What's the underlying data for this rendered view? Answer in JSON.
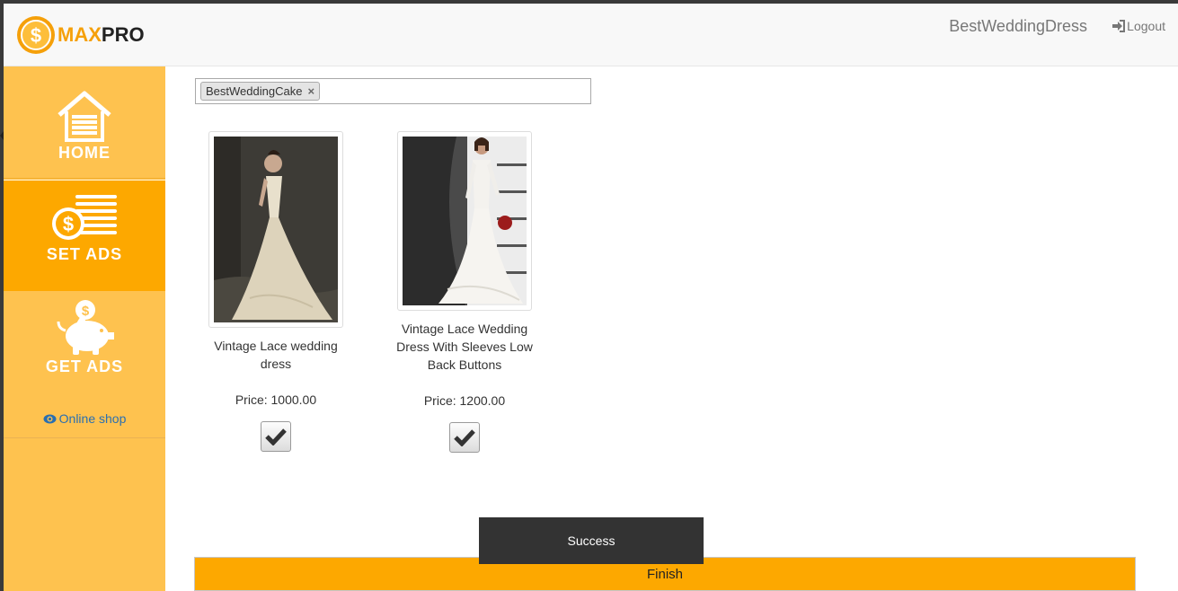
{
  "header": {
    "logo_max": "MAX",
    "logo_pro": "PRO",
    "username": "BestWeddingDress",
    "logout_label": "Logout"
  },
  "sidebar": {
    "items": [
      {
        "label": "HOME",
        "icon": "garage-home-icon"
      },
      {
        "label": "SET ADS",
        "icon": "coin-stack-icon",
        "active": true
      },
      {
        "label": "GET ADS",
        "icon": "piggy-bank-icon"
      }
    ],
    "online_shop": "Online shop"
  },
  "tag_input": {
    "tags": [
      "BestWeddingCake"
    ],
    "remove_glyph": "×"
  },
  "products": [
    {
      "title": "Vintage Lace wedding dress",
      "price": "Price: 1000.00",
      "checked": true
    },
    {
      "title": "Vintage Lace Wedding Dress With Sleeves Low Back Buttons",
      "price": "Price: 1200.00",
      "checked": true
    }
  ],
  "toast": "Success",
  "finish_label": "Finish",
  "colors": {
    "accent": "#fda800",
    "sidebar": "#fec24f",
    "toast": "#333333"
  }
}
